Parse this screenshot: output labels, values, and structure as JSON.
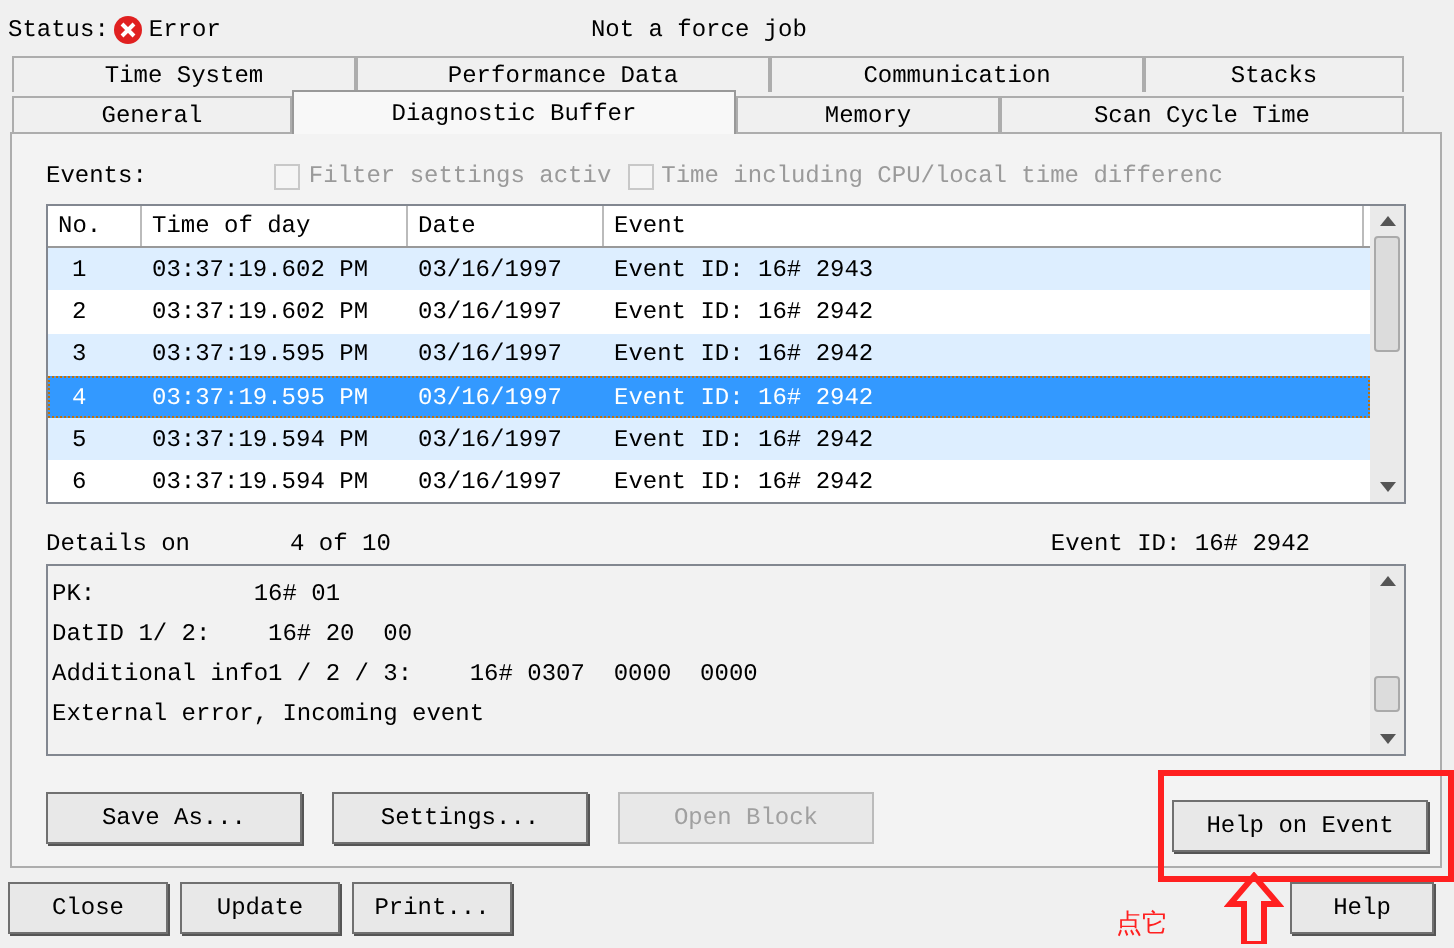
{
  "status": {
    "label": "Status:",
    "value": "Error",
    "note": "Not a force job"
  },
  "tab_rows": [
    [
      {
        "label": "Time System",
        "selected": false
      },
      {
        "label": "Performance Data",
        "selected": false
      },
      {
        "label": "Communication",
        "selected": false
      },
      {
        "label": "Stacks",
        "selected": false
      }
    ],
    [
      {
        "label": "General",
        "selected": false
      },
      {
        "label": "Diagnostic Buffer",
        "selected": true
      },
      {
        "label": "Memory",
        "selected": false
      },
      {
        "label": "Scan Cycle Time",
        "selected": false
      }
    ]
  ],
  "events_label": "Events:",
  "filters": [
    {
      "label": "Filter settings activ",
      "checked": false,
      "disabled": true
    },
    {
      "label": "Time including CPU/local time differenc",
      "checked": false,
      "disabled": true
    }
  ],
  "table": {
    "columns": [
      "No.",
      "Time of day",
      "Date",
      "Event"
    ],
    "rows": [
      {
        "cells": [
          "1",
          "03:37:19.602 PM",
          "03/16/1997",
          "Event ID: 16# 2943"
        ],
        "selected": false
      },
      {
        "cells": [
          "2",
          "03:37:19.602 PM",
          "03/16/1997",
          "Event ID: 16# 2942"
        ],
        "selected": false
      },
      {
        "cells": [
          "3",
          "03:37:19.595 PM",
          "03/16/1997",
          "Event ID: 16# 2942"
        ],
        "selected": false
      },
      {
        "cells": [
          "4",
          "03:37:19.595 PM",
          "03/16/1997",
          "Event ID: 16# 2942"
        ],
        "selected": true
      },
      {
        "cells": [
          "5",
          "03:37:19.594 PM",
          "03/16/1997",
          "Event ID: 16# 2942"
        ],
        "selected": false
      },
      {
        "cells": [
          "6",
          "03:37:19.594 PM",
          "03/16/1997",
          "Event ID: 16# 2942"
        ],
        "selected": false
      }
    ]
  },
  "details": {
    "label": "Details on",
    "position": "4 of 10",
    "event_id": "Event ID: 16# 2942",
    "lines": [
      "PK:           16# 01",
      "DatID 1/ 2:    16# 20  00",
      "Additional info1 / 2 / 3:    16# 0307  0000  0000",
      "External error, Incoming event"
    ]
  },
  "buttons": [
    {
      "label": "Save As...",
      "disabled": false
    },
    {
      "label": "Settings...",
      "disabled": false
    },
    {
      "label": "Open Block",
      "disabled": true
    },
    {
      "label": "Help on Event",
      "disabled": false,
      "highlighted": true
    }
  ],
  "footer_buttons": [
    {
      "label": "Close"
    },
    {
      "label": "Update"
    },
    {
      "label": "Print..."
    }
  ],
  "help_button": "Help",
  "annotation": "点它"
}
